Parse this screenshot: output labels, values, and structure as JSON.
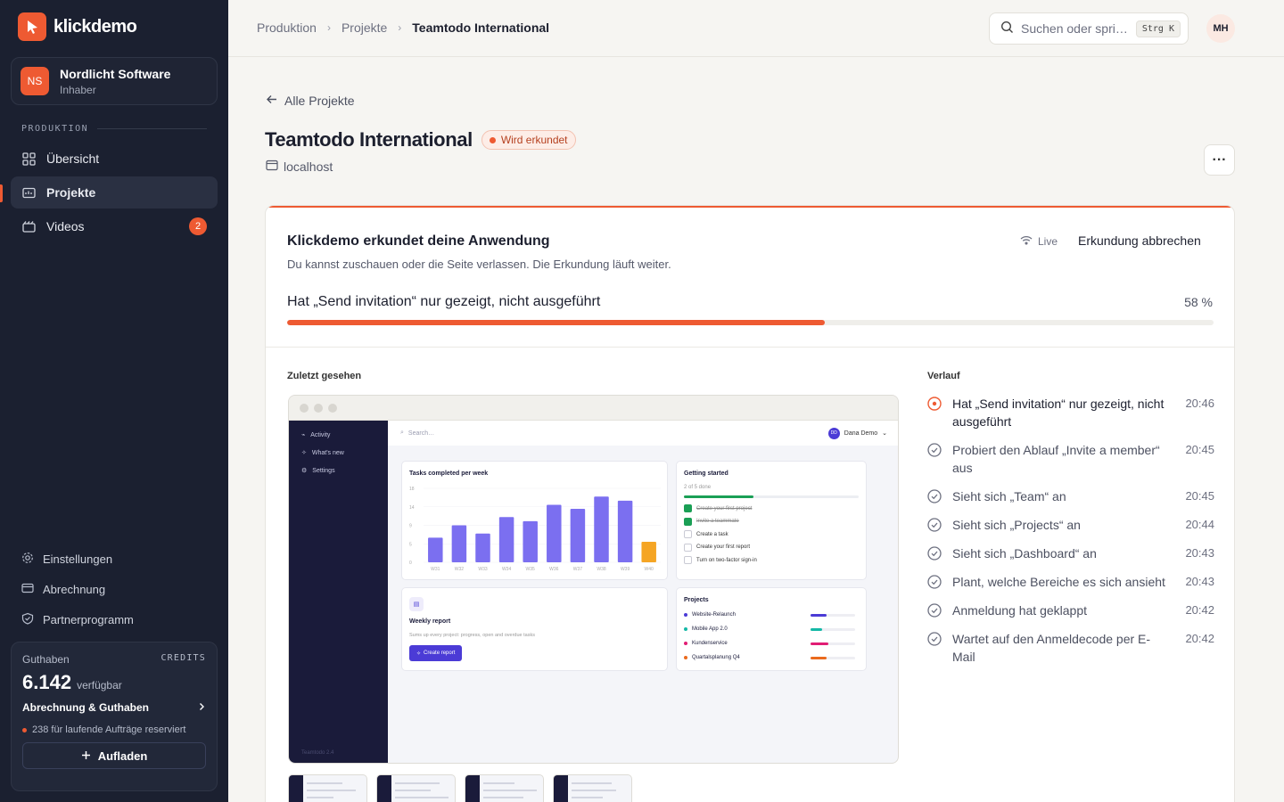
{
  "brand": {
    "name": "klickdemo"
  },
  "org": {
    "initials": "NS",
    "name": "Nordlicht Software",
    "role": "Inhaber"
  },
  "sidebar": {
    "section": "PRODUKTION",
    "items": [
      {
        "label": "Übersicht",
        "icon": "grid-icon"
      },
      {
        "label": "Projekte",
        "icon": "folder-icon",
        "active": true
      },
      {
        "label": "Videos",
        "icon": "film-icon",
        "badge": "2"
      }
    ],
    "bottom": [
      {
        "label": "Einstellungen",
        "icon": "gear-icon"
      },
      {
        "label": "Abrechnung",
        "icon": "card-icon"
      },
      {
        "label": "Partnerprogramm",
        "icon": "gift-icon"
      }
    ]
  },
  "credits": {
    "label": "Guthaben",
    "tag": "CREDITS",
    "amount": "6.142",
    "amount_label": "verfügbar",
    "link": "Abrechnung & Guthaben",
    "note": "238 für laufende Aufträge reserviert",
    "topup": "Aufladen"
  },
  "header": {
    "breadcrumb": [
      "Produktion",
      "Projekte",
      "Teamtodo International"
    ],
    "search_placeholder": "Suchen oder spri…",
    "search_kbd": "Strg K",
    "user_initials": "MH"
  },
  "page": {
    "back": "Alle Projekte",
    "title": "Teamtodo International",
    "status": "Wird erkundet",
    "host": "localhost",
    "more": "···"
  },
  "explore": {
    "title": "Klickdemo erkundet deine Anwendung",
    "subtitle": "Du kannst zuschauen oder die Seite verlassen. Die Erkundung läuft weiter.",
    "live": "Live",
    "abort": "Erkundung abbrechen",
    "step": "Hat „Send invitation“ nur gezeigt, nicht ausgeführt",
    "percent_label": "58 %",
    "progress": 0.58,
    "recent_label": "Zuletzt gesehen",
    "history_label": "Verlauf"
  },
  "history": [
    {
      "text": "Hat „Send invitation“ nur gezeigt, nicht ausgeführt",
      "time": "20:46",
      "current": true
    },
    {
      "text": "Probiert den Ablauf „Invite a member“ aus",
      "time": "20:45"
    },
    {
      "text": "Sieht sich „Team“ an",
      "time": "20:45"
    },
    {
      "text": "Sieht sich „Projects“ an",
      "time": "20:44"
    },
    {
      "text": "Sieht sich „Dashboard“ an",
      "time": "20:43"
    },
    {
      "text": "Plant, welche Bereiche es sich ansieht",
      "time": "20:43"
    },
    {
      "text": "Anmeldung hat geklappt",
      "time": "20:42"
    },
    {
      "text": "Wartet auf den Anmeldecode per E-Mail",
      "time": "20:42"
    }
  ],
  "preview": {
    "nav": [
      "Activity",
      "What's new",
      "Settings"
    ],
    "version": "Teamtodo 2.4",
    "search": "Search…",
    "user_initials": "DD",
    "user_name": "Dana Demo",
    "tasks_title": "Tasks completed per week",
    "chart_data": {
      "type": "bar",
      "categories": [
        "W31",
        "W32",
        "W33",
        "W34",
        "W35",
        "W36",
        "W37",
        "W38",
        "W39",
        "W40"
      ],
      "values": [
        6,
        9,
        7,
        11,
        10,
        14,
        13,
        16,
        15,
        5
      ],
      "yticks": [
        "0",
        "5",
        "9",
        "14",
        "18"
      ],
      "ylim": [
        0,
        18
      ]
    },
    "getting_started": {
      "title": "Getting started",
      "progress_label": "2 of 5 done",
      "items": [
        {
          "label": "Create your first project",
          "done": true
        },
        {
          "label": "Invite a teammate",
          "done": true
        },
        {
          "label": "Create a task",
          "done": false
        },
        {
          "label": "Create your first report",
          "done": false
        },
        {
          "label": "Turn on two-factor sign-in",
          "done": false
        }
      ]
    },
    "weekly": {
      "title": "Weekly report",
      "desc": "Sums up every project: progress, open and overdue tasks",
      "button": "Create report"
    },
    "projects": {
      "title": "Projects",
      "items": [
        {
          "name": "Website-Relaunch",
          "color": "#4b3bd6",
          "progress": 0.35
        },
        {
          "name": "Mobile App 2.0",
          "color": "#14b8a6",
          "progress": 0.25
        },
        {
          "name": "Kundenservice",
          "color": "#e11d74",
          "progress": 0.4
        },
        {
          "name": "Quartalsplanung Q4",
          "color": "#ea6a1d",
          "progress": 0.35
        }
      ]
    }
  },
  "colors": {
    "accent": "#ee5a32",
    "sidebar": "#1b2030",
    "preview_accent": "#4b3bd6"
  }
}
